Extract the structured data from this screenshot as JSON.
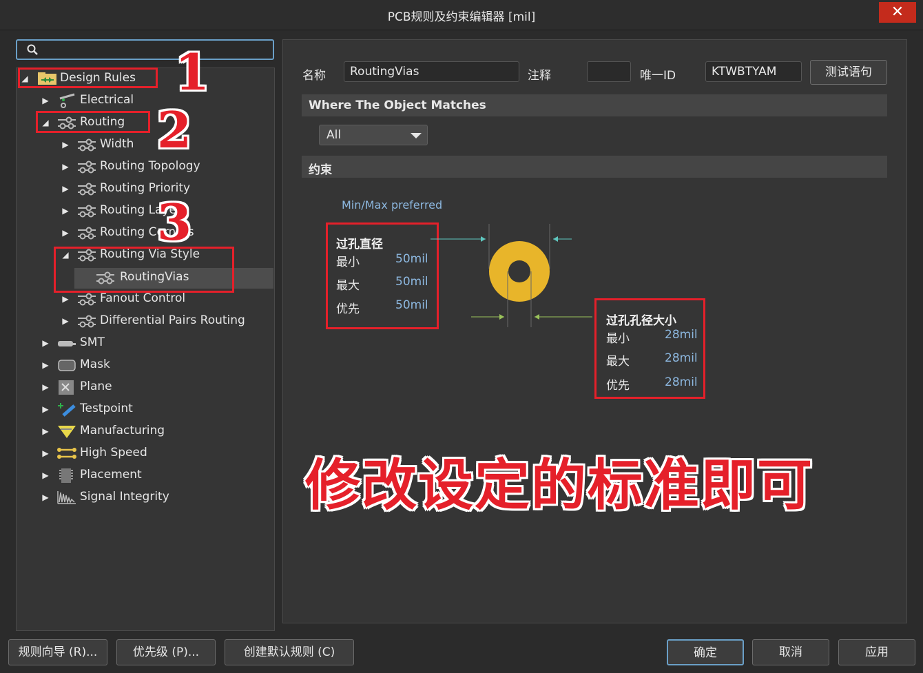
{
  "window": {
    "title": "PCB规则及约束编辑器 [mil]",
    "close_glyph": "✕"
  },
  "search": {
    "placeholder": ""
  },
  "tree": {
    "design_rules": "Design Rules",
    "electrical": "Electrical",
    "routing": "Routing",
    "width": "Width",
    "routing_topology": "Routing Topology",
    "routing_priority": "Routing Priority",
    "routing_layers": "Routing Layers",
    "routing_corners": "Routing Corners",
    "routing_via_style": "Routing Via Style",
    "routing_vias": "RoutingVias",
    "fanout_control": "Fanout Control",
    "differential_pairs": "Differential Pairs Routing",
    "smt": "SMT",
    "mask": "Mask",
    "plane": "Plane",
    "testpoint": "Testpoint",
    "manufacturing": "Manufacturing",
    "high_speed": "High Speed",
    "placement": "Placement",
    "signal_integrity": "Signal Integrity"
  },
  "annotations": {
    "n1": "1",
    "n2": "2",
    "n3": "3",
    "big": "修改设定的标准即可"
  },
  "form": {
    "name_label": "名称",
    "name_value": "RoutingVias",
    "comment_label": "注释",
    "comment_value": "",
    "uid_label": "唯一ID",
    "uid_value": "KTWBTYAM",
    "test_btn": "测试语句",
    "where_header": "Where The Object Matches",
    "where_value": "All",
    "constraint_header": "约束",
    "minmax": "Min/Max preferred"
  },
  "via_diameter": {
    "title": "过孔直径",
    "min_k": "最小",
    "min_v": "50mil",
    "max_k": "最大",
    "max_v": "50mil",
    "pref_k": "优先",
    "pref_v": "50mil"
  },
  "via_hole": {
    "title": "过孔孔径大小",
    "min_k": "最小",
    "min_v": "28mil",
    "max_k": "最大",
    "max_v": "28mil",
    "pref_k": "优先",
    "pref_v": "28mil"
  },
  "footer": {
    "wizard": "规则向导 (R)...",
    "priority": "优先级 (P)...",
    "defaults": "创建默认规则 (C)",
    "ok": "确定",
    "cancel": "取消",
    "apply": "应用"
  },
  "colors": {
    "annotation_red": "#e5202a",
    "via_ring": "#e8b52a",
    "value_blue": "#8db8e0"
  }
}
